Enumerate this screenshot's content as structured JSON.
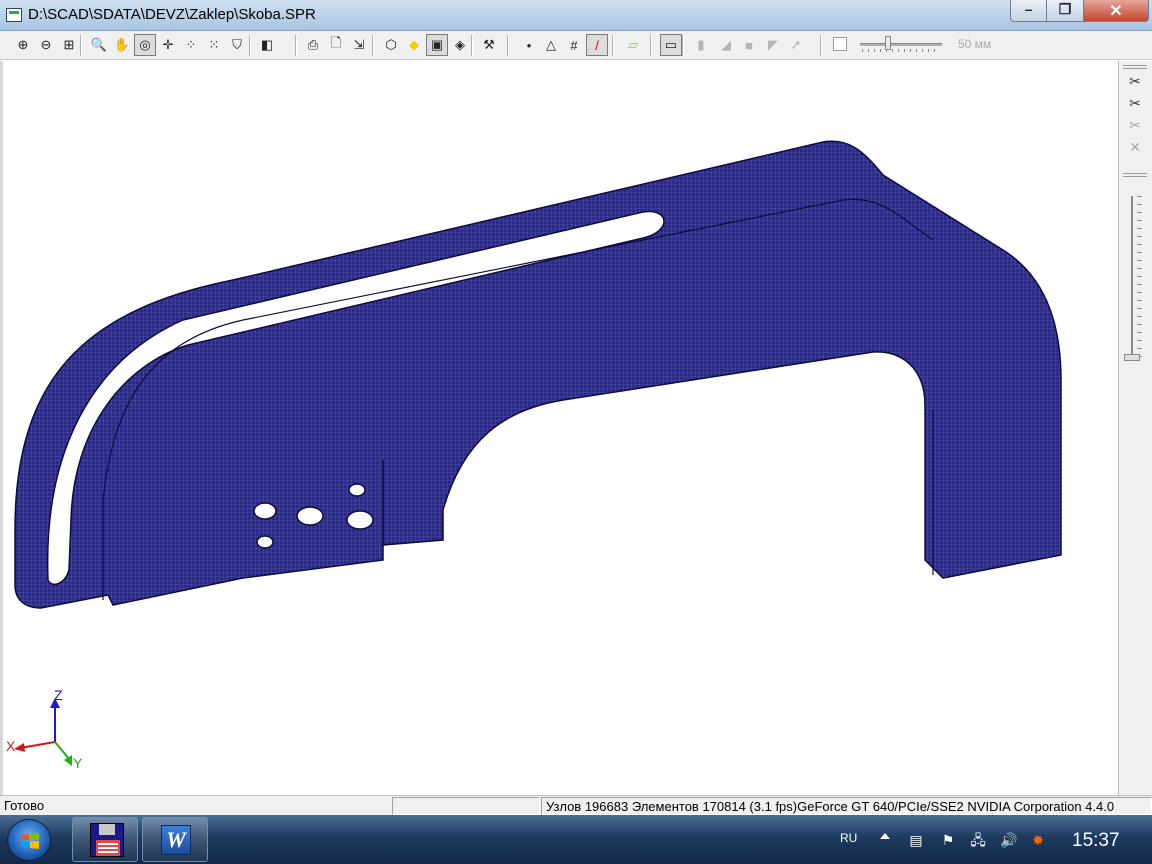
{
  "window": {
    "title": "D:\\SCAD\\SDATA\\DEVZ\\Zaklep\\Skoba.SPR",
    "controls": {
      "minimize": "–",
      "maximize": "❐",
      "close": "✕"
    }
  },
  "toolbar": {
    "buttons": [
      {
        "name": "zoom-in-icon",
        "glyph": "⊕"
      },
      {
        "name": "zoom-out-icon",
        "glyph": "⊖"
      },
      {
        "name": "zoom-fit-icon",
        "glyph": "⊞"
      },
      {
        "name": "zoom-window-icon",
        "glyph": "🔍"
      },
      {
        "name": "pan-hand-icon",
        "glyph": "✋"
      },
      {
        "name": "rotate-icon",
        "glyph": "◎"
      },
      {
        "name": "move-icon",
        "glyph": "✛"
      },
      {
        "name": "scatter-icon",
        "glyph": "⁘"
      },
      {
        "name": "nodes-icon",
        "glyph": "⁙"
      },
      {
        "name": "shield-icon",
        "glyph": "⛉"
      },
      {
        "name": "cube-view-icon",
        "glyph": "◧"
      },
      {
        "name": "print-icon",
        "glyph": "⎙"
      },
      {
        "name": "print-preview-icon",
        "glyph": "🗋"
      },
      {
        "name": "export-icon",
        "glyph": "⇲"
      },
      {
        "name": "wire-cube-icon",
        "glyph": "⬡"
      },
      {
        "name": "yellow-cube-icon",
        "glyph": "◆"
      },
      {
        "name": "solid-cube-icon",
        "glyph": "▣"
      },
      {
        "name": "shaded-cube-icon",
        "glyph": "◈"
      },
      {
        "name": "tools-icon",
        "glyph": "⚒"
      },
      {
        "name": "point-icon",
        "glyph": "•"
      },
      {
        "name": "triangle-nodes-icon",
        "glyph": "△"
      },
      {
        "name": "grid-icon",
        "glyph": "#"
      },
      {
        "name": "line-color-icon",
        "glyph": "/"
      },
      {
        "name": "fill-color-icon",
        "glyph": "▱"
      },
      {
        "name": "plate-icon",
        "glyph": "▭"
      },
      {
        "name": "disabled-tool-1-icon",
        "glyph": "▮"
      },
      {
        "name": "disabled-tool-2-icon",
        "glyph": "◢"
      },
      {
        "name": "disabled-tool-3-icon",
        "glyph": "■"
      },
      {
        "name": "disabled-tool-4-icon",
        "glyph": "◤"
      },
      {
        "name": "disabled-tool-5-icon",
        "glyph": "➚"
      }
    ],
    "slider_label": "50 мм",
    "slider_level": 0.3
  },
  "right_panel": {
    "buttons": [
      {
        "name": "cut-icon",
        "glyph": "✂"
      },
      {
        "name": "cut-section-icon",
        "glyph": "✂"
      },
      {
        "name": "cut-disabled-icon",
        "glyph": "✂"
      },
      {
        "name": "cut-cross-icon",
        "glyph": "✕"
      }
    ]
  },
  "axes": {
    "x": "X",
    "y": "Y",
    "z": "Z"
  },
  "statusbar": {
    "ready": "Готово",
    "info": "Узлов 196683  Элементов 170814  (3.1 fps)GeForce GT 640/PCIe/SSE2 NVIDIA Corporation 4.4.0"
  },
  "taskbar": {
    "language": "RU",
    "clock": "15:37"
  },
  "colors": {
    "mesh_fill": "#2b2b85",
    "mesh_line": "#6a6ac8",
    "mesh_edge": "#0c0c40"
  }
}
